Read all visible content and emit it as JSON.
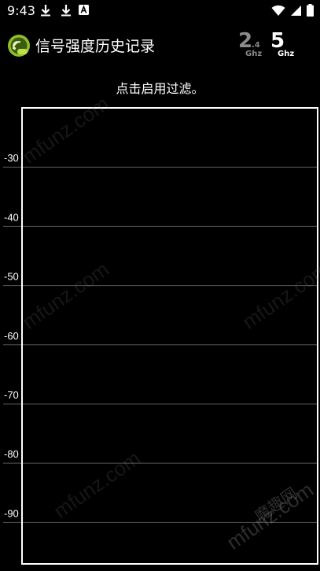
{
  "status_bar": {
    "time": "9:43",
    "notification_icons": [
      "download-icon",
      "download-icon",
      "a-app-icon"
    ],
    "system_icons": [
      "wifi-icon",
      "signal-icon",
      "battery-icon"
    ]
  },
  "app_bar": {
    "title": "信号强度历史记录",
    "logo_icon": "wifi-app-logo",
    "band_24": {
      "num": "2",
      "sub": ".4",
      "unit": "Ghz",
      "color": "#8a8a8a"
    },
    "band_5": {
      "num": "5",
      "unit": "Ghz",
      "color": "#ffffff"
    }
  },
  "hint": "点击启用过滤。",
  "watermark": {
    "text": "mfunz.com",
    "logo_text": "魔趣网"
  },
  "chart_data": {
    "type": "line",
    "title": "",
    "xlabel": "",
    "ylabel": "",
    "ylim": [
      -97,
      -20
    ],
    "yticks": [
      -30,
      -40,
      -50,
      -60,
      -70,
      -80,
      -90
    ],
    "ytick_labels": [
      "-30",
      "-40",
      "-50",
      "-60",
      "-70",
      "-80",
      "-90"
    ],
    "grid": true,
    "series": [],
    "colors": {
      "frame": "#ffffff",
      "grid": "#555555",
      "background": "#000000"
    }
  }
}
